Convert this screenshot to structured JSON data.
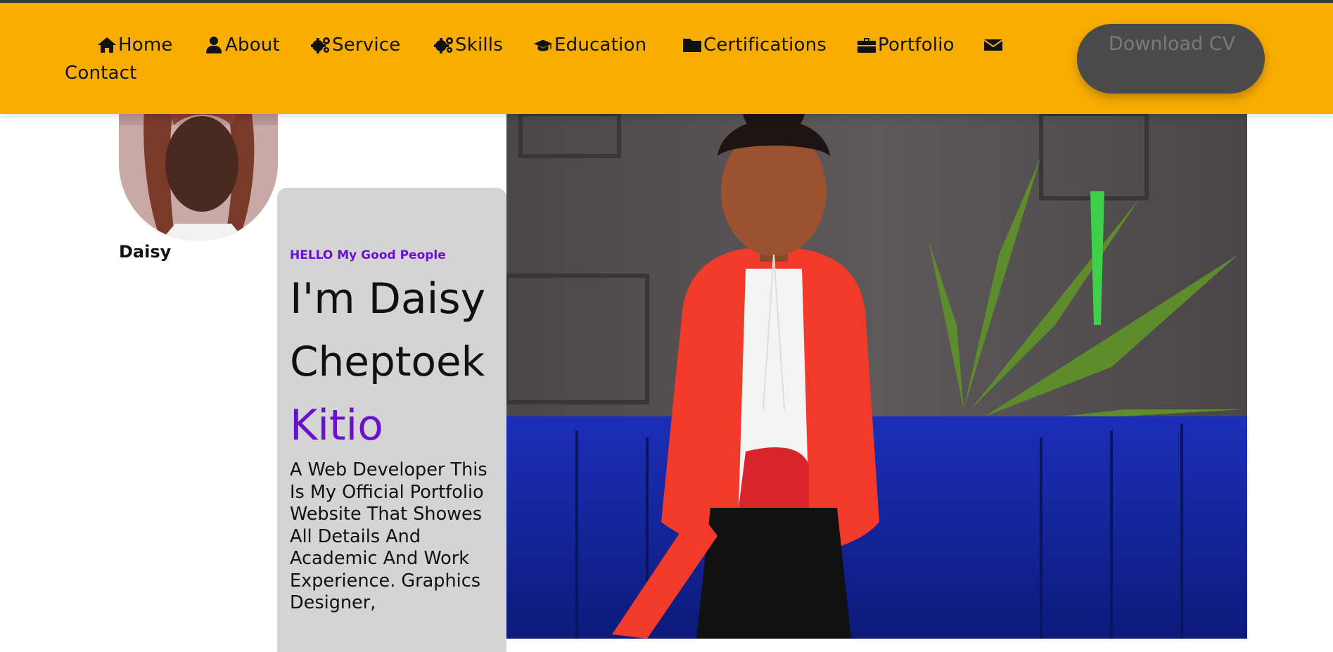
{
  "nav": {
    "items": [
      {
        "label": "Home",
        "icon": "home-icon"
      },
      {
        "label": "About",
        "icon": "user-icon"
      },
      {
        "label": "Service",
        "icon": "gears-icon"
      },
      {
        "label": "Skills",
        "icon": "gears-icon"
      },
      {
        "label": "Education",
        "icon": "graduation-cap-icon"
      },
      {
        "label": "Certifications",
        "icon": "folder-icon"
      },
      {
        "label": "Portfolio",
        "icon": "briefcase-icon"
      },
      {
        "label": "Contact",
        "icon": "envelope-icon"
      }
    ],
    "download_cv": "Download CV"
  },
  "profile": {
    "name": "Daisy"
  },
  "hero": {
    "greeting": "HELLO My Good People",
    "name_line1": "I'm Daisy",
    "name_line2": "Cheptoek",
    "name_accent": "Kitio",
    "description": "A Web Developer This Is My Official Portfolio Website That Showes All Details And Academic And Work Experience. Graphics Designer,"
  },
  "colors": {
    "nav_background": "#f9ad00",
    "accent": "#6a11cb",
    "card_background": "#d4d4d4",
    "button_background": "#4a4a4a",
    "button_text": "#7a7a7a"
  }
}
